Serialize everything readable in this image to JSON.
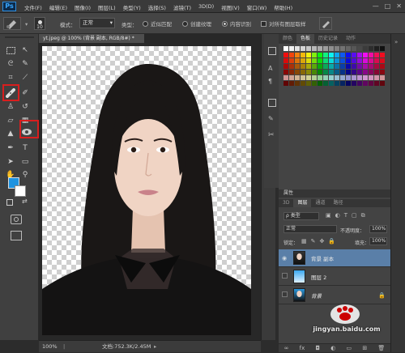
{
  "app": {
    "logo": "Ps",
    "menus": [
      "文件(F)",
      "编辑(E)",
      "图像(I)",
      "图层(L)",
      "类型(Y)",
      "选择(S)",
      "滤镜(T)",
      "3D(D)",
      "视图(V)",
      "窗口(W)",
      "帮助(H)"
    ],
    "window_controls": [
      "—",
      "□",
      "✕"
    ]
  },
  "options_bar": {
    "brush_size": "10",
    "mode_label": "模式：",
    "mode_value": "正常",
    "type_label": "类型：",
    "type_options": [
      {
        "label": "近似匹配",
        "selected": false
      },
      {
        "label": "创建纹理",
        "selected": false
      },
      {
        "label": "内容识别",
        "selected": true
      }
    ],
    "sample_all_layers_label": "对所有图层取样",
    "sample_all_layers_checked": false
  },
  "document": {
    "tab_title": "yt.jpeg @ 100% (背景 副本, RGB/8#) *",
    "zoom": "100%",
    "doc_size": "文档:752.3K/2.45M"
  },
  "toolbox": {
    "foreground_color": "#1f93e0",
    "background_color": "#ffffff",
    "highlighted_tools": [
      "spot-healing-brush-tool",
      "red-eye-tool"
    ]
  },
  "swatch_panel": {
    "tabs": [
      {
        "label": "颜色",
        "active": false
      },
      {
        "label": "色板",
        "active": true
      },
      {
        "label": "历史记录",
        "active": false
      },
      {
        "label": "动作",
        "active": false
      }
    ]
  },
  "layers_panel": {
    "properties_title": "属性",
    "tabs": [
      {
        "label": "3D",
        "active": false
      },
      {
        "label": "图层",
        "active": true
      },
      {
        "label": "通道",
        "active": false
      },
      {
        "label": "路径",
        "active": false
      }
    ],
    "filter_kind": "ρ 类型",
    "blend_mode": "正常",
    "opacity_label": "不透明度：",
    "opacity_value": "100%",
    "lock_label": "锁定：",
    "fill_label": "填充：",
    "fill_value": "100%",
    "layers": [
      {
        "name": "背景 副本",
        "visible": true,
        "selected": true,
        "kind": "photo"
      },
      {
        "name": "图层 2",
        "visible": false,
        "selected": false,
        "kind": "gradient"
      },
      {
        "name": "背景",
        "visible": false,
        "selected": false,
        "kind": "photo",
        "locked": true
      }
    ]
  },
  "watermark": {
    "text": "jingyan.baidu.com"
  },
  "accent_colors": {
    "highlight_red": "#d81e1e",
    "selected_layer": "#5a7fa8",
    "ps_blue": "#39a8ff"
  }
}
